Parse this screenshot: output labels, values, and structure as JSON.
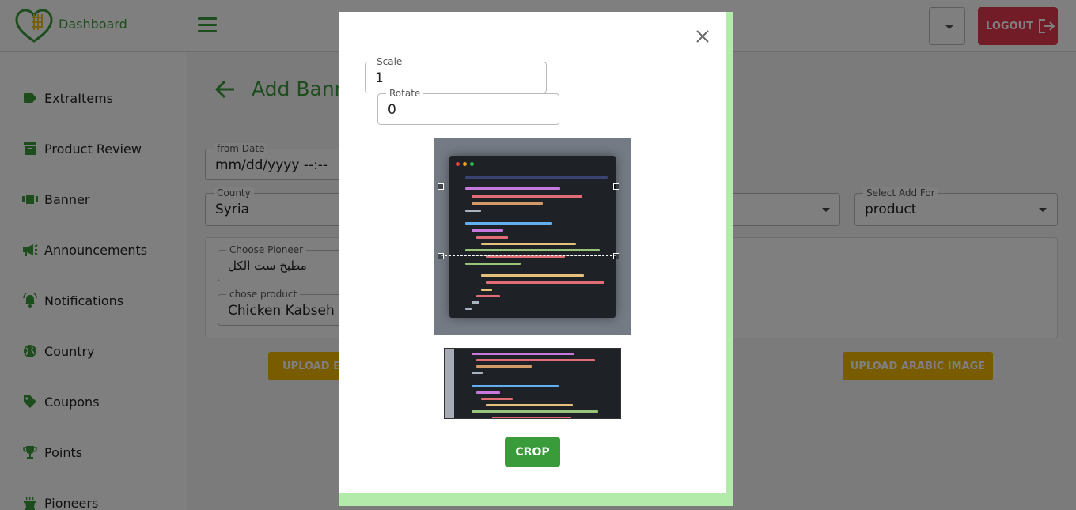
{
  "header": {
    "brand": "Dashboard",
    "logout_label": "LOGOUT"
  },
  "sidebar": {
    "items": [
      {
        "label": "ExtraItems",
        "icon": "label-tag-icon"
      },
      {
        "label": "Product Review",
        "icon": "archive-box-icon"
      },
      {
        "label": "Banner",
        "icon": "view-carousel-icon"
      },
      {
        "label": "Announcements",
        "icon": "megaphone-icon"
      },
      {
        "label": "Notifications",
        "icon": "bell-alert-icon"
      },
      {
        "label": "Country",
        "icon": "globe-icon"
      },
      {
        "label": "Coupons",
        "icon": "tag-icon"
      },
      {
        "label": "Points",
        "icon": "trophy-icon"
      },
      {
        "label": "Pioneers",
        "icon": "cooking-pot-icon"
      }
    ]
  },
  "page": {
    "title": "Add Bann",
    "from_date_label": "from Date",
    "from_date_value": "mm/dd/yyyy --:--",
    "county_label": "County",
    "county_value": "Syria",
    "select_add_for_label": "Select Add For",
    "select_add_for_value": "product",
    "pioneer_label": "Choose Pioneer",
    "pioneer_value": "مطبخ ست الكل",
    "product_label": "chose product",
    "product_value": "Chicken Kabseh",
    "upload_en_label": "UPLOAD EN",
    "upload_ar_label": "UPLOAD ARABIC IMAGE"
  },
  "modal": {
    "scale_label": "Scale",
    "scale_value": "1",
    "rotate_label": "Rotate",
    "rotate_value": "0",
    "crop_label": "CROP"
  },
  "colors": {
    "brand_green": "#3a9b3a",
    "logout_red": "#e53950",
    "upload_yellow": "#f3b800",
    "modal_accent": "#b3ebaa"
  }
}
